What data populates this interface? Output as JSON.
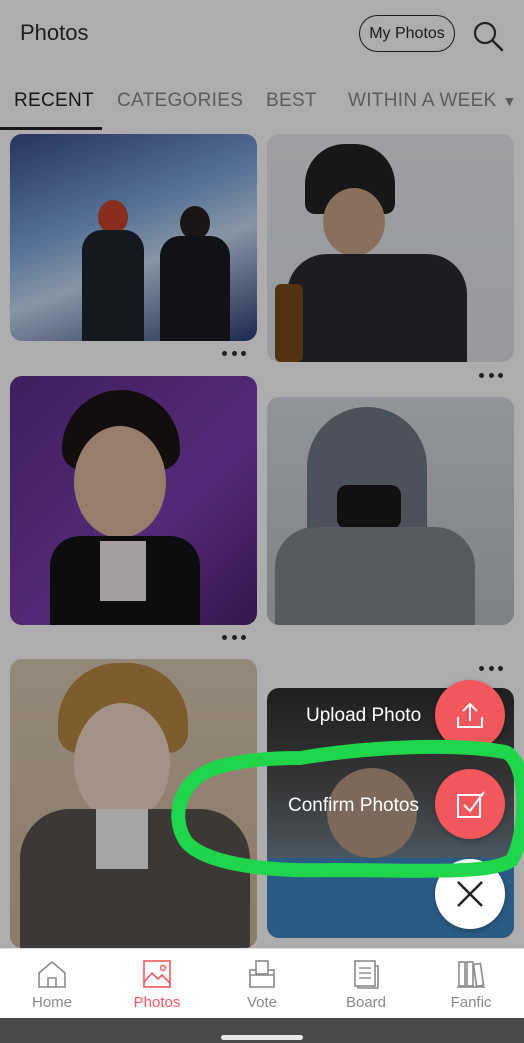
{
  "header": {
    "title": "Photos",
    "my_photos_label": "My Photos"
  },
  "tabs": [
    {
      "label": "RECENT",
      "active": true
    },
    {
      "label": "CATEGORIES",
      "active": false
    },
    {
      "label": "BEST",
      "active": false
    },
    {
      "label": "WITHIN A WEEK",
      "active": false
    }
  ],
  "fab_menu": {
    "upload_label": "Upload Photo",
    "confirm_label": "Confirm Photos",
    "accent_color": "#f2575c",
    "highlight_color": "#1fd64a"
  },
  "bottom_nav": [
    {
      "label": "Home",
      "icon": "home-icon",
      "active": false
    },
    {
      "label": "Photos",
      "icon": "photos-icon",
      "active": true
    },
    {
      "label": "Vote",
      "icon": "vote-icon",
      "active": false
    },
    {
      "label": "Board",
      "icon": "board-icon",
      "active": false
    },
    {
      "label": "Fanfic",
      "icon": "fanfic-icon",
      "active": false
    }
  ]
}
